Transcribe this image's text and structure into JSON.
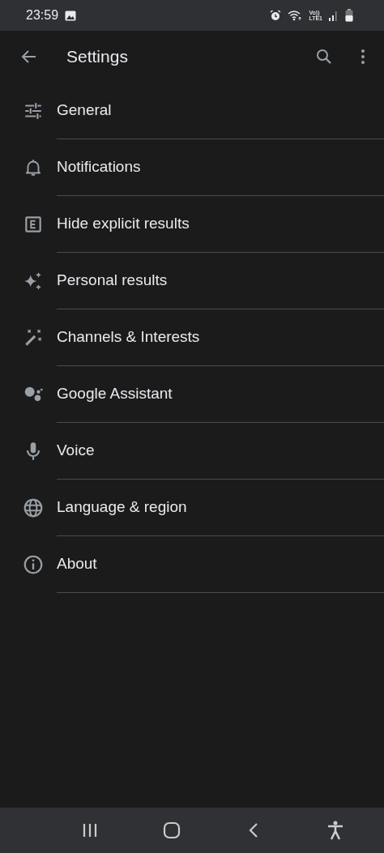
{
  "status_bar": {
    "time": "23:59",
    "network_top": "Vo))",
    "network_bottom": "LTE1"
  },
  "app_bar": {
    "title": "Settings"
  },
  "items": [
    {
      "label": "General"
    },
    {
      "label": "Notifications"
    },
    {
      "label": "Hide explicit results"
    },
    {
      "label": "Personal results"
    },
    {
      "label": "Channels & Interests"
    },
    {
      "label": "Google Assistant"
    },
    {
      "label": "Voice"
    },
    {
      "label": "Language & region"
    },
    {
      "label": "About"
    }
  ]
}
